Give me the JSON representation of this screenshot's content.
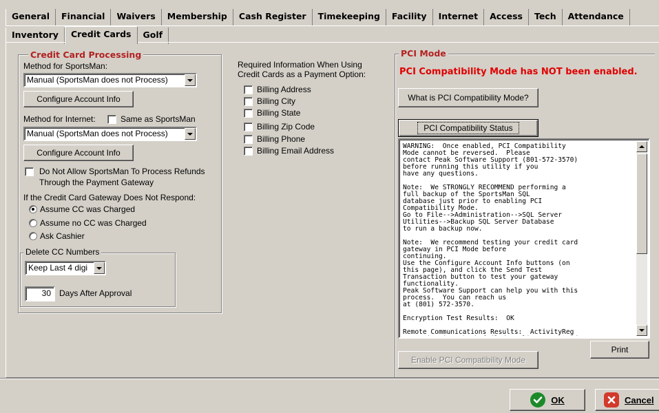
{
  "tabs_row1": [
    "General",
    "Financial",
    "Waivers",
    "Membership",
    "Cash Register",
    "Timekeeping",
    "Facility",
    "Internet",
    "Access",
    "Tech",
    "Attendance"
  ],
  "tabs_row2": [
    "Inventory",
    "Credit Cards",
    "Golf"
  ],
  "active_tab": "Credit Cards",
  "cc": {
    "group_title": "Credit Card Processing",
    "method_sportsman_label": "Method for SportsMan:",
    "method_sportsman_value": "Manual (SportsMan does not Process)",
    "configure1": "Configure Account Info",
    "method_internet_label": "Method for Internet:",
    "same_as_label": "Same as SportsMan",
    "method_internet_value": "Manual (SportsMan does not Process)",
    "configure2": "Configure Account Info",
    "no_refunds_line1": "Do Not Allow SportsMan To Process Refunds",
    "no_refunds_line2": "Through the Payment Gateway",
    "gateway_label": "If the Credit Card Gateway Does Not Respond:",
    "radio_charged": "Assume CC was Charged",
    "radio_not_charged": "Assume no CC was Charged",
    "radio_ask": "Ask Cashier",
    "delete_group": "Delete CC Numbers",
    "delete_value": "Keep Last 4 digi",
    "days_value": "30",
    "days_label": "Days After Approval"
  },
  "required": {
    "title_line1": "Required Information When Using",
    "title_line2": "Credit Cards as a Payment Option:",
    "items": [
      "Billing Address",
      "Billing City",
      "Billing State",
      "Billing Zip Code",
      "Billing Phone",
      "Billing Email Address"
    ]
  },
  "pci": {
    "group_title": "PCI Mode",
    "warning": "PCI Compatibility Mode has NOT been enabled.",
    "what_button": "What is PCI Compatibility Mode?",
    "status_button": "PCI Compatibility Status",
    "log_text": "WARNING:  Once enabled, PCI Compatibility\nMode cannot be reversed.  Please\ncontact Peak Software Support (801-572-3570)\nbefore running this utility if you\nhave any questions.\n\nNote:  We STRONGLY RECOMMEND performing a\nfull backup of the SportsMan SQL\ndatabase just prior to enabling PCI\nCompatibility Mode.\nGo to File-->Administration-->SQL Server\nUtilities-->Backup SQL Server Database\nto run a backup now.\n\nNote:  We recommend testing your credit card\ngateway in PCI Mode before\ncontinuing.\nUse the Configure Account Info buttons (on\nthis page), and click the Send Test\nTransaction button to test your gateway\nfunctionality.\nPeak Software Support can help you with this\nprocess.  You can reach us\nat (801) 572-3570.\n\nEncryption Test Results:  OK\n\nRemote Communications Results:  ActivityReg\nCommunication Check failed:  Client Password",
    "print_button": "Print",
    "enable_button": "Enable PCI Compatibility Mode"
  },
  "footer": {
    "ok_label": "OK",
    "cancel_label": "Cancel"
  },
  "colors": {
    "pci_red": "#e00000",
    "title_red": "#b22222",
    "ok_green": "#1c8a2a",
    "cancel_red": "#d23a2a"
  }
}
